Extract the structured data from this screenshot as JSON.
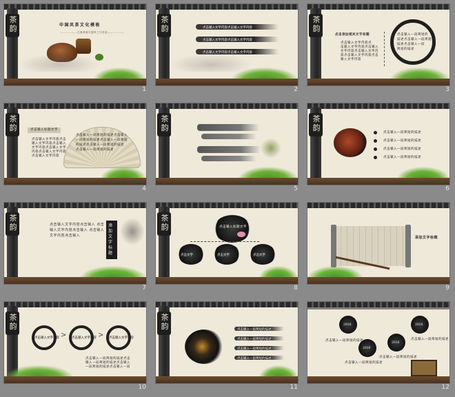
{
  "slides": [
    {
      "num": "1",
      "title": "中国风茶文化模板",
      "subtitle": "——————古典风格中国风工作总结——————",
      "glyph": "茶韵"
    },
    {
      "num": "2",
      "lines": [
        "点击输入文字内容点击输入文字内容",
        "点击输入文字内容点击输入文字内容",
        "点击输入文字内容点击输入文字内容"
      ],
      "glyph": "茶韵"
    },
    {
      "num": "3",
      "heading": "点击添加相关文字标题",
      "bullets": [
        "点击输入文字内容点",
        "击输入文字内容点击输入",
        "文字内容点击输入文字内",
        "容点击输入文字内容点击",
        "输入文字内容"
      ],
      "ring_text": [
        "点击输入一段简短的",
        "描述点击输入一段简短",
        "描述点击输入一段",
        "简短的描述"
      ],
      "glyph": "茶韵"
    },
    {
      "num": "4",
      "box_label": "点击输入标题文字",
      "para": [
        "点击输入文字内容点击",
        "输入文字内容点击输入",
        "文字内容点击输入文字",
        "内容点击输入文字内容",
        "点击输入文字内容"
      ],
      "fan_text": [
        "点击输入一段简短的描述点击输入",
        "一段简短的描述点击输入一段简短",
        "的描述点击输入一段简短的描述",
        "点击输入一段简短的描述"
      ],
      "glyph": "茶韵"
    },
    {
      "num": "5",
      "glyph": "茶韵"
    },
    {
      "num": "6",
      "items": [
        "点击输入一段简短的描述",
        "点击输入一段简短的描述",
        "点击输入一段简短的描述",
        "点击输入一段简短的描述"
      ],
      "glyph": "茶韵"
    },
    {
      "num": "7",
      "columns": [
        "点",
        "击",
        "输",
        "入",
        "文",
        "字",
        "内",
        "容",
        "点",
        "击",
        "输",
        "入"
      ],
      "vertical_title": "添加文字标题",
      "glyph": "茶韵"
    },
    {
      "num": "8",
      "top_label": "点击输入标题文字",
      "circles": [
        "点击文字",
        "点击文字",
        "点击文字"
      ],
      "glyph": "茶韵"
    },
    {
      "num": "9",
      "scroll_title": "添加文字标题",
      "glyph": "茶韵"
    },
    {
      "num": "10",
      "circles": [
        "点击输入文字内容",
        "点击输入文字内容",
        "点击输入文字内容"
      ],
      "desc": [
        "点击输入一段简短的描述点击",
        "输入一段简短的描述点击输入",
        "一段简短的描述点击输入一段"
      ],
      "glyph": "茶韵"
    },
    {
      "num": "11",
      "lines": [
        "点击输入一段简短的描述",
        "点击输入一段简短的描述",
        "点击输入一段简短的描述",
        "点击输入一段简短的描述"
      ],
      "glyph": "茶韵"
    },
    {
      "num": "12",
      "nodes": [
        "2016",
        "2016",
        "2016",
        "2016"
      ],
      "captions": [
        "点击输入一段简短的描述",
        "点击输入一段简短的描述",
        "点击输入一段简短的描述",
        "点击输入一段简短的描述"
      ],
      "glyph": "茶韵"
    }
  ]
}
